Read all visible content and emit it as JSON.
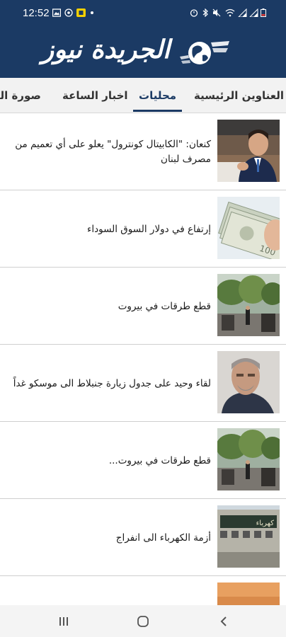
{
  "status_bar": {
    "time": "12:52"
  },
  "header": {
    "logo_text": "الجريدة نيوز"
  },
  "tabs": [
    {
      "label": "العناوين الرئيسية",
      "active": false
    },
    {
      "label": "محليات",
      "active": true
    },
    {
      "label": "اخبار الساعة",
      "active": false
    },
    {
      "label": "صورة اليوم",
      "active": false
    }
  ],
  "news": [
    {
      "headline": "كنعان: \"الكابيتال كونترول\" يعلو على أي تعميم من مصرف لبنان",
      "thumb": "politician-icon"
    },
    {
      "headline": "إرتفاع في دولار السوق السوداء",
      "thumb": "dollar-bills-icon"
    },
    {
      "headline": "قطع طرقات في بيروت",
      "thumb": "street-blocked-icon"
    },
    {
      "headline": "لقاء وحيد على جدول زيارة جنبلاط الى موسكو غداً",
      "thumb": "portrait-icon"
    },
    {
      "headline": "قطع طرقات في بيروت...",
      "thumb": "street-blocked-icon"
    },
    {
      "headline": "أزمة الكهرباء الى انفراج",
      "thumb": "electricity-building-icon"
    },
    {
      "headline": "",
      "thumb": "partial-image"
    }
  ],
  "colors": {
    "brand": "#1b3a64",
    "tab_bg": "#f2f2f2"
  }
}
